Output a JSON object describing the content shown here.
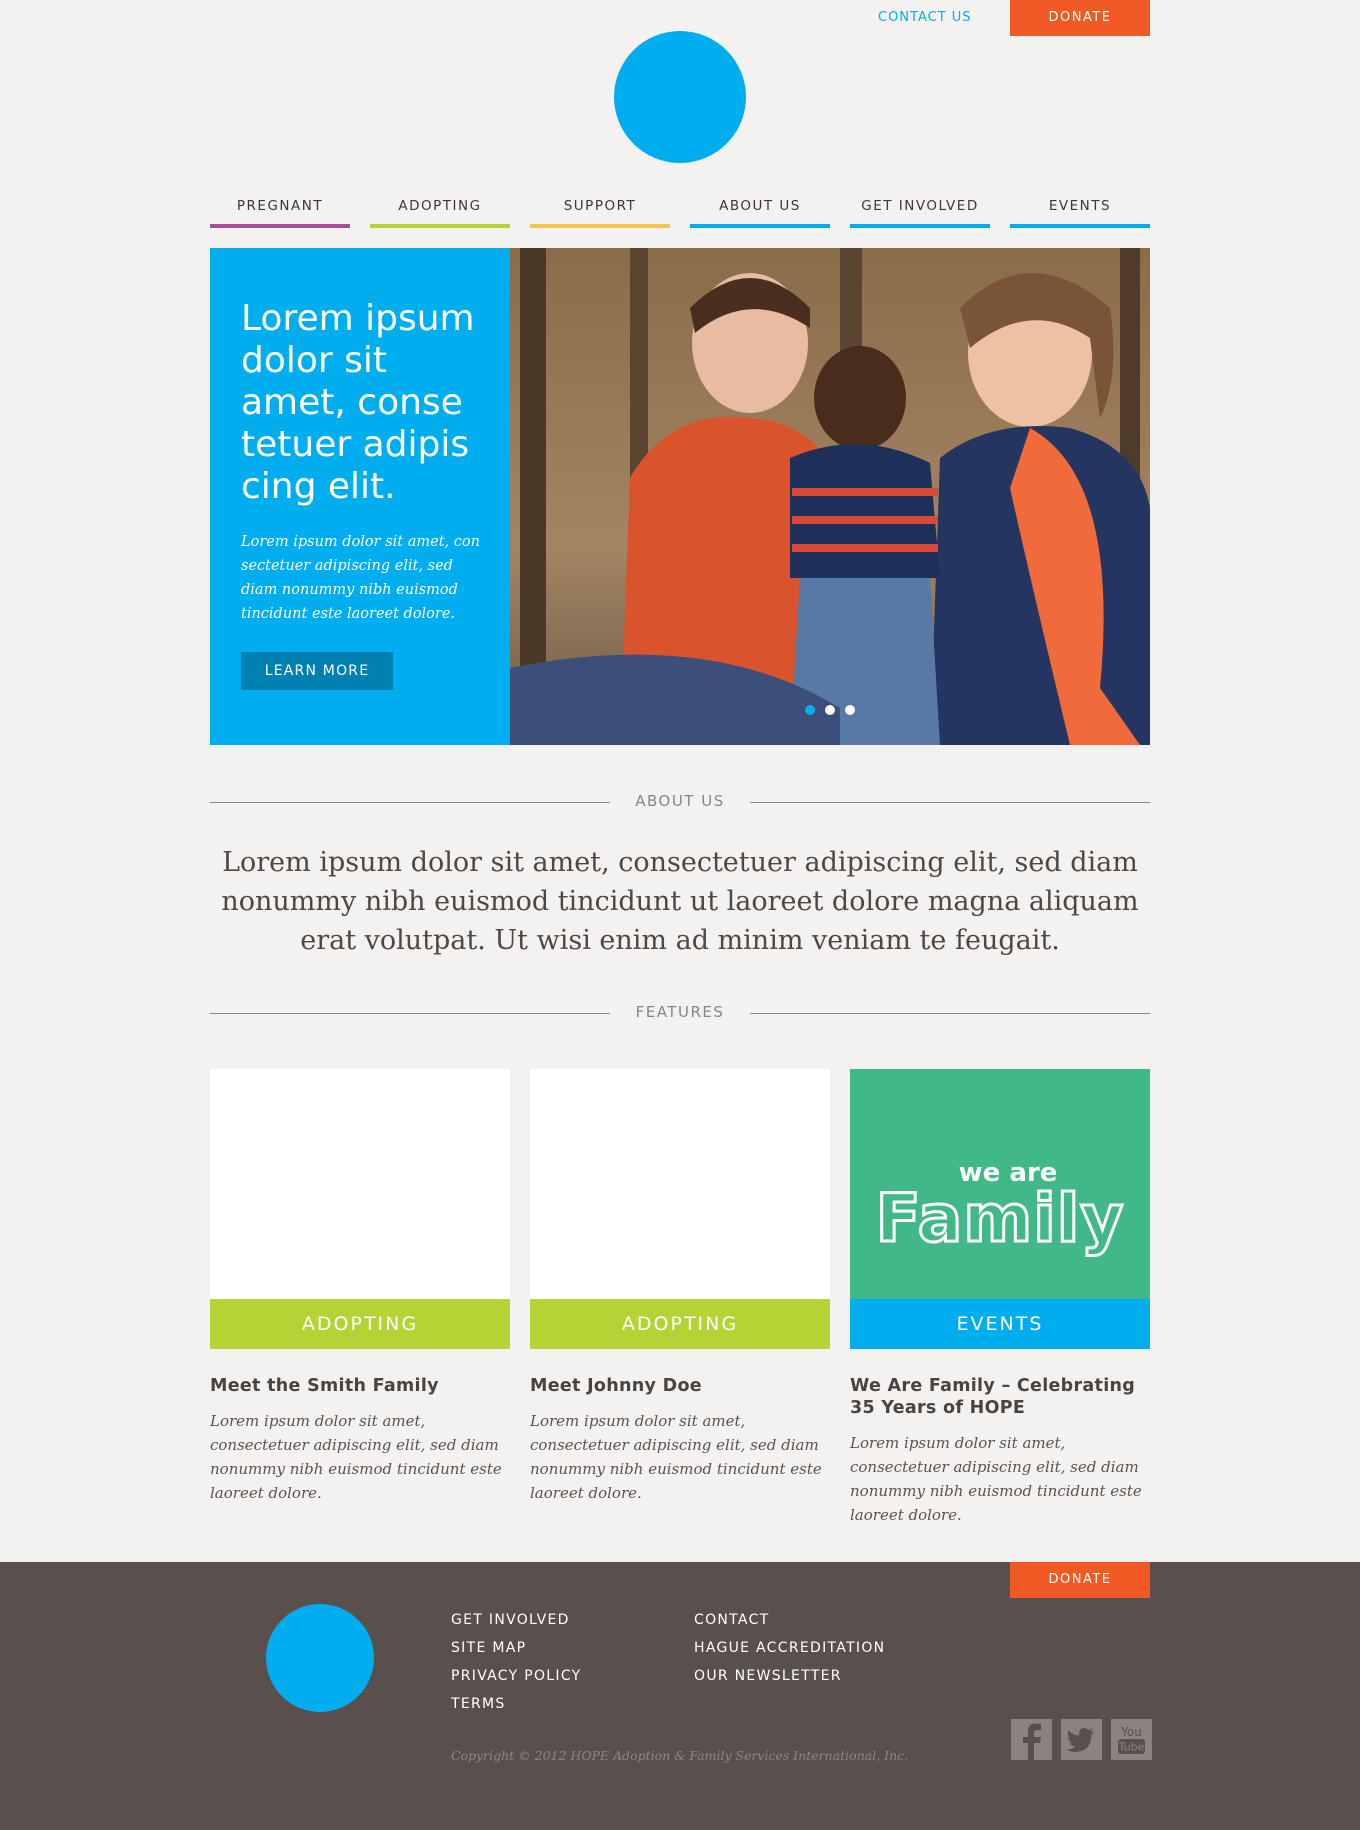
{
  "header": {
    "contact_label": "CONTACT US",
    "donate_label": "DONATE"
  },
  "nav": {
    "items": [
      {
        "label": "PREGNANT",
        "color": "#a54e9e"
      },
      {
        "label": "ADOPTING",
        "color": "#b5d334"
      },
      {
        "label": "SUPPORT",
        "color": "#f7c54a"
      },
      {
        "label": "ABOUT US",
        "color": "#00aeef"
      },
      {
        "label": "GET INVOLVED",
        "color": "#00aeef"
      },
      {
        "label": "EVENTS",
        "color": "#00aeef"
      }
    ]
  },
  "hero": {
    "title": "Lorem ipsum dolor sit amet, conse tetuer adipis cing elit.",
    "text": "Lorem ipsum dolor sit amet, con sectetuer adipiscing elit, sed diam nonummy nibh euismod tincidunt este laoreet dolore.",
    "button_label": "LEARN MORE",
    "slides": {
      "count": 3,
      "active": 1
    }
  },
  "about": {
    "heading": "ABOUT US",
    "text": "Lorem ipsum dolor sit amet, consectetuer adipiscing elit, sed diam nonummy nibh euismod tincidunt ut laoreet dolore magna aliquam erat volutpat. Ut wisi enim ad minim veniam te feugait."
  },
  "features": {
    "heading": "FEATURES",
    "cards": [
      {
        "tag": "ADOPTING",
        "tag_color": "#b5d334",
        "title": "Meet the Smith Family",
        "text": "Lorem ipsum dolor sit amet, consectetuer adipiscing elit, sed diam nonummy nibh euismod tincidunt este laoreet dolore."
      },
      {
        "tag": "ADOPTING",
        "tag_color": "#b5d334",
        "title": "Meet Johnny Doe",
        "text": "Lorem ipsum dolor sit amet, consectetuer adipiscing elit, sed diam nonummy nibh euismod tincidunt este laoreet dolore."
      },
      {
        "tag": "EVENTS",
        "tag_color": "#00aeef",
        "title": "We Are Family – Celebrating 35 Years of HOPE",
        "text": "Lorem ipsum dolor sit amet, consectetuer adipiscing elit, sed diam nonummy nibh euismod tincidunt este laoreet dolore.",
        "image_text_small": "we are",
        "image_text_large": "Family"
      }
    ]
  },
  "footer": {
    "donate_label": "DONATE",
    "col1": [
      "GET INVOLVED",
      "SITE MAP",
      "PRIVACY POLICY",
      "TERMS"
    ],
    "col2": [
      "CONTACT",
      "HAGUE ACCREDITATION",
      "OUR NEWSLETTER"
    ],
    "copyright": "Copyright © 2012 HOPE Adoption & Family Services International, Inc.",
    "social": [
      {
        "icon": "facebook-icon",
        "glyph": "f"
      },
      {
        "icon": "twitter-icon",
        "glyph": "t"
      },
      {
        "icon": "youtube-icon",
        "glyph": "You Tube"
      }
    ]
  }
}
